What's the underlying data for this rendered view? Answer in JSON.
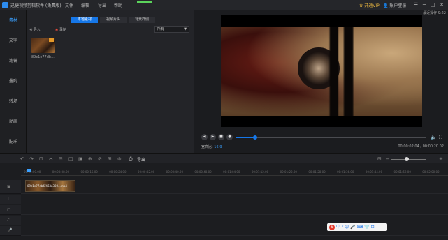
{
  "app": {
    "title": "迅捷视频剪辑软件 (免费版)",
    "menu": [
      "文件",
      "编辑",
      "导出",
      "帮助"
    ],
    "vip": "开通VIP",
    "login": "账户登录",
    "win_controls": [
      "☰",
      "─",
      "□",
      "✕"
    ],
    "top_progress": 1.0
  },
  "sidebar": {
    "items": [
      {
        "label": "素材",
        "active": true
      },
      {
        "label": "文字",
        "active": false
      },
      {
        "label": "滤镜",
        "active": false
      },
      {
        "label": "叠附",
        "active": false
      },
      {
        "label": "转场",
        "active": false
      },
      {
        "label": "动画",
        "active": false
      },
      {
        "label": "配乐",
        "active": false
      }
    ]
  },
  "media": {
    "tabs": [
      {
        "label": "本地素材",
        "active": true
      },
      {
        "label": "视频片头",
        "active": false
      },
      {
        "label": "背景样例",
        "active": false
      }
    ],
    "import_label": "导入",
    "record_label": "录制",
    "filter_value": "所有",
    "filter_arrow": "▼",
    "items": [
      {
        "name": "89c1e77db..."
      }
    ]
  },
  "preview": {
    "label": "最近操作 9:22",
    "ratio_label": "宽高比:",
    "ratio_value": "16:9",
    "timecode": "00:00:02.04 / 00:00:20.02",
    "progress": 0.1,
    "controls": [
      "◀",
      "▶",
      "■",
      "●"
    ],
    "volume_icon": "🔈",
    "fullscreen_icon": "⛶"
  },
  "toolbar": {
    "icons": [
      "↶",
      "↷",
      "⊡",
      "✂",
      "⊟",
      "◫",
      "▣",
      "⊕",
      "⊘",
      "⊞",
      "⊜",
      "⎙"
    ],
    "export_label": "导出",
    "zoom_out": "−",
    "zoom_in": "+"
  },
  "timeline": {
    "ticks": [
      "00:00:00.00",
      "00:00:08.00",
      "00:00:16.00",
      "00:00:24.00",
      "00:00:32.00",
      "00:00:40.00",
      "00:00:48.00",
      "00:01:04.00",
      "00:01:12.00",
      "00:01:20.00",
      "00:01:28.00",
      "00:01:36.00",
      "00:01:44.00",
      "00:01:52.00",
      "00:02:00.00"
    ],
    "track_icons": [
      "▣",
      "T",
      "▢",
      "♪",
      "🎤"
    ],
    "clip_label": "89c1e77db6f463a339...mp4"
  },
  "ime": {
    "logo": "S",
    "items": "中 ⁰ ☺ 🎤 ⌨ 👕 ⊞"
  }
}
